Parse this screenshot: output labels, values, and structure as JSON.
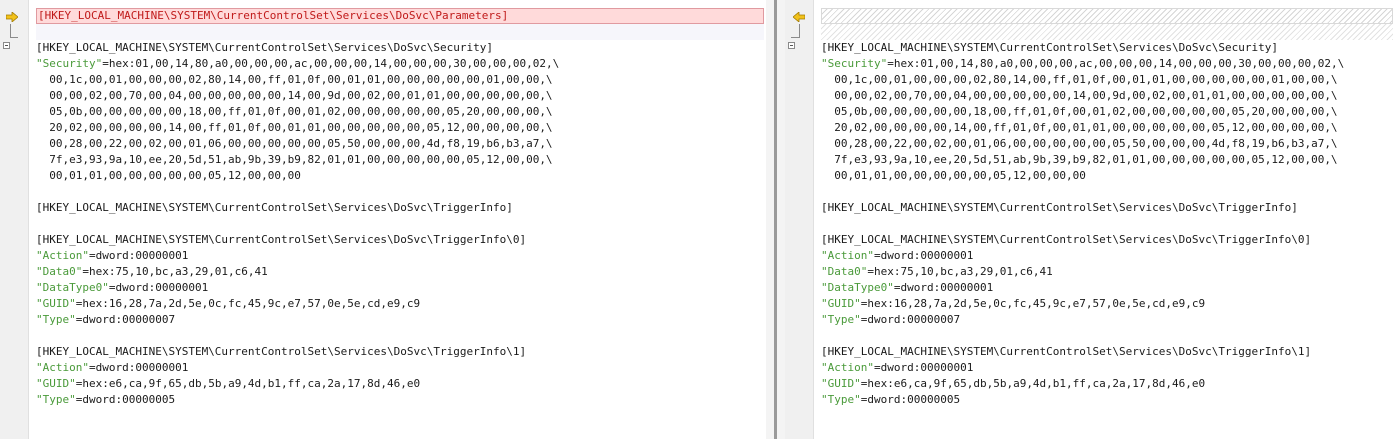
{
  "left": {
    "removed_line": "[HKEY_LOCAL_MACHINE\\SYSTEM\\CurrentControlSet\\Services\\DoSvc\\Parameters]",
    "lines": [
      {
        "kind": "blank"
      },
      {
        "kind": "key",
        "text": "[HKEY_LOCAL_MACHINE\\SYSTEM\\CurrentControlSet\\Services\\DoSvc\\Security]"
      },
      {
        "kind": "value",
        "name": "\"Security\"",
        "rest": "=hex:01,00,14,80,a0,00,00,00,ac,00,00,00,14,00,00,00,30,00,00,00,02,\\"
      },
      {
        "kind": "plain",
        "text": "  00,1c,00,01,00,00,00,02,80,14,00,ff,01,0f,00,01,01,00,00,00,00,00,01,00,00,\\"
      },
      {
        "kind": "plain",
        "text": "  00,00,02,00,70,00,04,00,00,00,00,00,14,00,9d,00,02,00,01,01,00,00,00,00,00,\\"
      },
      {
        "kind": "plain",
        "text": "  05,0b,00,00,00,00,00,18,00,ff,01,0f,00,01,02,00,00,00,00,00,05,20,00,00,00,\\"
      },
      {
        "kind": "plain",
        "text": "  20,02,00,00,00,00,14,00,ff,01,0f,00,01,01,00,00,00,00,00,05,12,00,00,00,00,\\"
      },
      {
        "kind": "plain",
        "text": "  00,28,00,22,00,02,00,01,06,00,00,00,00,00,05,50,00,00,00,4d,f8,19,b6,b3,a7,\\"
      },
      {
        "kind": "plain",
        "text": "  7f,e3,93,9a,10,ee,20,5d,51,ab,9b,39,b9,82,01,01,00,00,00,00,00,05,12,00,00,\\"
      },
      {
        "kind": "plain",
        "text": "  00,01,01,00,00,00,00,00,05,12,00,00,00"
      },
      {
        "kind": "blank"
      },
      {
        "kind": "key",
        "text": "[HKEY_LOCAL_MACHINE\\SYSTEM\\CurrentControlSet\\Services\\DoSvc\\TriggerInfo]"
      },
      {
        "kind": "blank"
      },
      {
        "kind": "key",
        "text": "[HKEY_LOCAL_MACHINE\\SYSTEM\\CurrentControlSet\\Services\\DoSvc\\TriggerInfo\\0]"
      },
      {
        "kind": "value",
        "name": "\"Action\"",
        "rest": "=dword:00000001"
      },
      {
        "kind": "value",
        "name": "\"Data0\"",
        "rest": "=hex:75,10,bc,a3,29,01,c6,41"
      },
      {
        "kind": "value",
        "name": "\"DataType0\"",
        "rest": "=dword:00000001"
      },
      {
        "kind": "value",
        "name": "\"GUID\"",
        "rest": "=hex:16,28,7a,2d,5e,0c,fc,45,9c,e7,57,0e,5e,cd,e9,c9"
      },
      {
        "kind": "value",
        "name": "\"Type\"",
        "rest": "=dword:00000007"
      },
      {
        "kind": "blank"
      },
      {
        "kind": "key",
        "text": "[HKEY_LOCAL_MACHINE\\SYSTEM\\CurrentControlSet\\Services\\DoSvc\\TriggerInfo\\1]"
      },
      {
        "kind": "value",
        "name": "\"Action\"",
        "rest": "=dword:00000001"
      },
      {
        "kind": "value",
        "name": "\"GUID\"",
        "rest": "=hex:e6,ca,9f,65,db,5b,a9,4d,b1,ff,ca,2a,17,8d,46,e0"
      },
      {
        "kind": "value",
        "name": "\"Type\"",
        "rest": "=dword:00000005"
      }
    ]
  },
  "right": {
    "lines": [
      {
        "kind": "blank"
      },
      {
        "kind": "key",
        "text": "[HKEY_LOCAL_MACHINE\\SYSTEM\\CurrentControlSet\\Services\\DoSvc\\Security]"
      },
      {
        "kind": "value",
        "name": "\"Security\"",
        "rest": "=hex:01,00,14,80,a0,00,00,00,ac,00,00,00,14,00,00,00,30,00,00,00,02,\\"
      },
      {
        "kind": "plain",
        "text": "  00,1c,00,01,00,00,00,02,80,14,00,ff,01,0f,00,01,01,00,00,00,00,00,01,00,00,\\"
      },
      {
        "kind": "plain",
        "text": "  00,00,02,00,70,00,04,00,00,00,00,00,14,00,9d,00,02,00,01,01,00,00,00,00,00,\\"
      },
      {
        "kind": "plain",
        "text": "  05,0b,00,00,00,00,00,18,00,ff,01,0f,00,01,02,00,00,00,00,00,05,20,00,00,00,\\"
      },
      {
        "kind": "plain",
        "text": "  20,02,00,00,00,00,14,00,ff,01,0f,00,01,01,00,00,00,00,00,05,12,00,00,00,00,\\"
      },
      {
        "kind": "plain",
        "text": "  00,28,00,22,00,02,00,01,06,00,00,00,00,00,05,50,00,00,00,4d,f8,19,b6,b3,a7,\\"
      },
      {
        "kind": "plain",
        "text": "  7f,e3,93,9a,10,ee,20,5d,51,ab,9b,39,b9,82,01,01,00,00,00,00,00,05,12,00,00,\\"
      },
      {
        "kind": "plain",
        "text": "  00,01,01,00,00,00,00,00,05,12,00,00,00"
      },
      {
        "kind": "blank"
      },
      {
        "kind": "key",
        "text": "[HKEY_LOCAL_MACHINE\\SYSTEM\\CurrentControlSet\\Services\\DoSvc\\TriggerInfo]"
      },
      {
        "kind": "blank"
      },
      {
        "kind": "key",
        "text": "[HKEY_LOCAL_MACHINE\\SYSTEM\\CurrentControlSet\\Services\\DoSvc\\TriggerInfo\\0]"
      },
      {
        "kind": "value",
        "name": "\"Action\"",
        "rest": "=dword:00000001"
      },
      {
        "kind": "value",
        "name": "\"Data0\"",
        "rest": "=hex:75,10,bc,a3,29,01,c6,41"
      },
      {
        "kind": "value",
        "name": "\"DataType0\"",
        "rest": "=dword:00000001"
      },
      {
        "kind": "value",
        "name": "\"GUID\"",
        "rest": "=hex:16,28,7a,2d,5e,0c,fc,45,9c,e7,57,0e,5e,cd,e9,c9"
      },
      {
        "kind": "value",
        "name": "\"Type\"",
        "rest": "=dword:00000007"
      },
      {
        "kind": "blank"
      },
      {
        "kind": "key",
        "text": "[HKEY_LOCAL_MACHINE\\SYSTEM\\CurrentControlSet\\Services\\DoSvc\\TriggerInfo\\1]"
      },
      {
        "kind": "value",
        "name": "\"Action\"",
        "rest": "=dword:00000001"
      },
      {
        "kind": "value",
        "name": "\"GUID\"",
        "rest": "=hex:e6,ca,9f,65,db,5b,a9,4d,b1,ff,ca,2a,17,8d,46,e0"
      },
      {
        "kind": "value",
        "name": "\"Type\"",
        "rest": "=dword:00000005"
      }
    ]
  },
  "icons": {
    "left_marker": "diff-arrow-right-icon",
    "right_marker": "diff-arrow-left-icon",
    "fold": "collapse-icon"
  },
  "colors": {
    "removed_bg": "#ffdada",
    "removed_text": "#c01a1a",
    "value_name": "#4a9a3a"
  }
}
